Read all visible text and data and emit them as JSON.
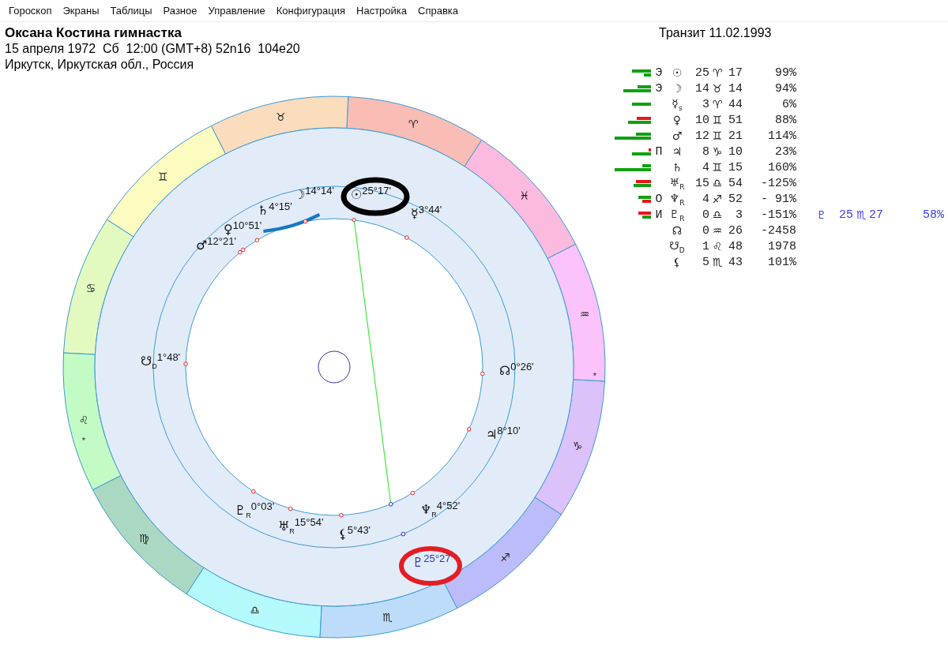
{
  "menu": [
    "Гороскоп",
    "Экраны",
    "Таблицы",
    "Разное",
    "Управление",
    "Конфигурация",
    "Настройка",
    "Справка"
  ],
  "chart_header": {
    "name": "Оксана Костина гимнастка",
    "details": "15 апреля 1972  Сб  12:00 (GMT+8) 52n16  104e20",
    "place": "Иркутск, Иркутская обл., Россия"
  },
  "transit": {
    "title": "Транзит 11.02.1993"
  },
  "wheel": {
    "signs": [
      {
        "glyph": "♈",
        "color": "#f9bdb6"
      },
      {
        "glyph": "♉",
        "color": "#fbdcbc"
      },
      {
        "glyph": "♊",
        "color": "#fcfcc0"
      },
      {
        "glyph": "♋",
        "color": "#e2fac0"
      },
      {
        "glyph": "♌",
        "color": "#c2fcc4",
        "mark": "*"
      },
      {
        "glyph": "♍",
        "color": "#aad8c2"
      },
      {
        "glyph": "♎",
        "color": "#b4f9fb"
      },
      {
        "glyph": "♏",
        "color": "#bcdcfa"
      },
      {
        "glyph": "♐",
        "color": "#bcbcfa"
      },
      {
        "glyph": "♑",
        "color": "#dcc2fb"
      },
      {
        "glyph": "♒",
        "color": "#fbc2fb",
        "mark": "*"
      },
      {
        "glyph": "♓",
        "color": "#fbbade"
      }
    ],
    "natal": [
      {
        "glyph": "☉",
        "label": "25°17'",
        "circled": true,
        "aspect": true
      },
      {
        "glyph": "☽",
        "label": "14°14'",
        "circled": false,
        "aspect": false
      },
      {
        "glyph": "♄",
        "label": "4°15'",
        "circled": false,
        "aspect": false
      },
      {
        "glyph": "♀",
        "label": "10°51'",
        "circled": false,
        "aspect": false
      },
      {
        "glyph": "♂",
        "label": "12°21'",
        "circled": false,
        "aspect": false
      },
      {
        "glyph": "☿",
        "label": "3°44'",
        "circled": false,
        "aspect": false
      },
      {
        "glyph": "☋",
        "sub": "D",
        "label": "1°48'",
        "circled": false,
        "aspect": false
      },
      {
        "glyph": "☊",
        "label": "0°26'",
        "circled": false,
        "aspect": false
      },
      {
        "glyph": "♃",
        "label": "8°10'",
        "circled": false,
        "aspect": false
      },
      {
        "glyph": "♆",
        "sub": "R",
        "label": "4°52'",
        "circled": false,
        "aspect": false
      },
      {
        "glyph": "⚸",
        "label": "5°43'",
        "circled": false,
        "aspect": false
      },
      {
        "glyph": "♅",
        "sub": "R",
        "label": "15°54'",
        "circled": false,
        "aspect": false
      },
      {
        "glyph": "♇",
        "sub": "R",
        "label": "0°03'",
        "circled": false,
        "aspect": false
      }
    ],
    "transit": [
      {
        "glyph": "♇",
        "label": "25°27'",
        "circled": true
      }
    ]
  },
  "table": {
    "rows": [
      {
        "bars": [
          {
            "kind": "plus",
            "level": 0.5
          },
          {
            "kind": "plus",
            "level": 0.18
          }
        ],
        "letter": "Э",
        "glyph": "☉",
        "deg": "25",
        "sign": "♈",
        "min": "17",
        "pct": "99%"
      },
      {
        "bars": [
          {
            "kind": "plus",
            "level": 0.36
          },
          {
            "kind": "plus",
            "level": 0.73
          }
        ],
        "letter": "Э",
        "glyph": "☽",
        "deg": "14",
        "sign": "♉",
        "min": "14",
        "pct": "94%"
      },
      {
        "bars": [
          {
            "kind": "plus",
            "level": 0.5
          }
        ],
        "glyph": "☿",
        "sub": "s",
        "deg": "3",
        "sign": "♈",
        "min": "44",
        "pct": "6%"
      },
      {
        "bars": [
          {
            "kind": "minus",
            "level": 0.38
          },
          {
            "kind": "plus",
            "level": 0.6
          }
        ],
        "glyph": "♀",
        "deg": "10",
        "sign": "♊",
        "min": "51",
        "pct": "88%"
      },
      {
        "bars": [
          {
            "kind": "plus",
            "level": 0.4
          },
          {
            "kind": "plus",
            "level": 0.96
          }
        ],
        "glyph": "♂",
        "deg": "12",
        "sign": "♊",
        "min": "21",
        "pct": "114%"
      },
      {
        "bars": [
          {
            "kind": "minus",
            "level": 0.07
          },
          {
            "kind": "plus",
            "level": 0.5
          }
        ],
        "letter": "П",
        "glyph": "♃",
        "deg": "8",
        "sign": "♑",
        "min": "10",
        "pct": "23%"
      },
      {
        "bars": [
          {
            "kind": "plus",
            "level": 0.22
          },
          {
            "kind": "plus",
            "level": 0.96
          }
        ],
        "glyph": "♄",
        "deg": "4",
        "sign": "♊",
        "min": "15",
        "pct": "160%"
      },
      {
        "bars": [
          {
            "kind": "minus",
            "level": 0.4
          },
          {
            "kind": "plus",
            "level": 0.45
          }
        ],
        "glyph": "♅",
        "sub": "R",
        "deg": "15",
        "sign": "♎",
        "min": "54",
        "pct": "-125%"
      },
      {
        "bars": [
          {
            "kind": "plus",
            "level": 0.33
          },
          {
            "kind": "minus",
            "level": 0.22
          }
        ],
        "letter": "О",
        "glyph": "♆",
        "sub": "R",
        "deg": "4",
        "sign": "♐",
        "min": "52",
        "pct": "- 91%"
      },
      {
        "bars": [
          {
            "kind": "minus",
            "level": 0.33
          },
          {
            "kind": "plus",
            "level": 0.22
          }
        ],
        "letter": "И",
        "glyph": "♇",
        "sub": "R",
        "deg": "0",
        "sign": "♎",
        "min": "3",
        "pct": "-151%",
        "transit": {
          "glyph": "♇",
          "deg": "25",
          "sign": "♏",
          "min": "27",
          "pct": "58%"
        }
      },
      {
        "glyph": "☊",
        "deg": "0",
        "sign": "♒",
        "min": "26",
        "pct": "-2458"
      },
      {
        "glyph": "☋",
        "sub": "D",
        "deg": "1",
        "sign": "♌",
        "min": "48",
        "pct": "1978"
      },
      {
        "glyph": "⚸",
        "deg": "5",
        "sign": "♏",
        "min": "43",
        "pct": "101%"
      }
    ]
  }
}
